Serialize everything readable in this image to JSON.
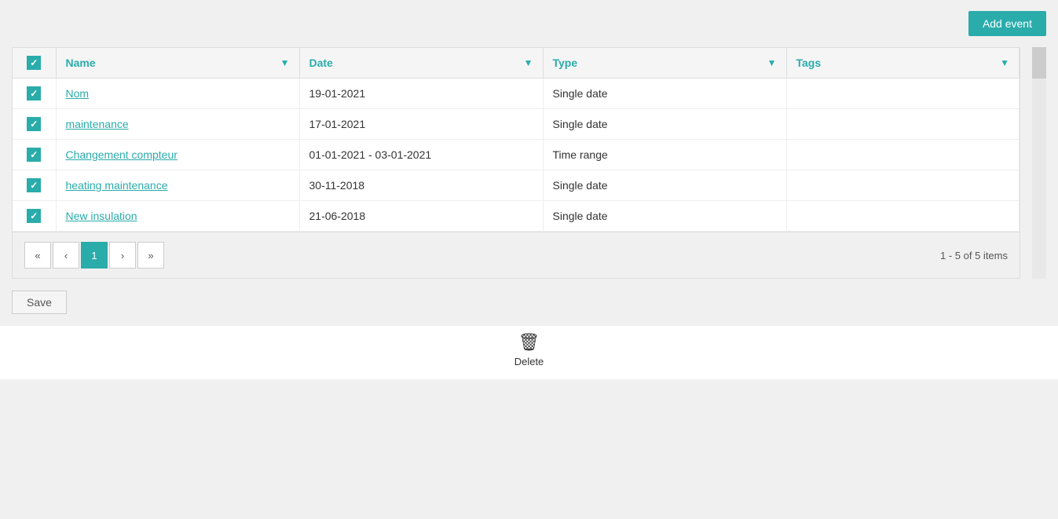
{
  "header": {
    "add_event_label": "Add event"
  },
  "table": {
    "columns": [
      {
        "id": "checkbox",
        "label": ""
      },
      {
        "id": "name",
        "label": "Name"
      },
      {
        "id": "date",
        "label": "Date"
      },
      {
        "id": "type",
        "label": "Type"
      },
      {
        "id": "tags",
        "label": "Tags"
      }
    ],
    "rows": [
      {
        "checked": true,
        "name": "Nom",
        "date": "19-01-2021",
        "type": "Single date",
        "tags": ""
      },
      {
        "checked": true,
        "name": "maintenance",
        "date": "17-01-2021",
        "type": "Single date",
        "tags": ""
      },
      {
        "checked": true,
        "name": "Changement compteur",
        "date": "01-01-2021 - 03-01-2021",
        "type": "Time range",
        "tags": ""
      },
      {
        "checked": true,
        "name": "heating maintenance",
        "date": "30-11-2018",
        "type": "Single date",
        "tags": ""
      },
      {
        "checked": true,
        "name": "New insulation",
        "date": "21-06-2018",
        "type": "Single date",
        "tags": ""
      }
    ]
  },
  "pagination": {
    "current_page": 1,
    "pages": [
      1
    ],
    "info": "1 - 5 of 5 items",
    "first_label": "«",
    "prev_label": "‹",
    "next_label": "›",
    "last_label": "»"
  },
  "footer": {
    "save_label": "Save",
    "delete_label": "Delete",
    "delete_icon": "🗑"
  }
}
